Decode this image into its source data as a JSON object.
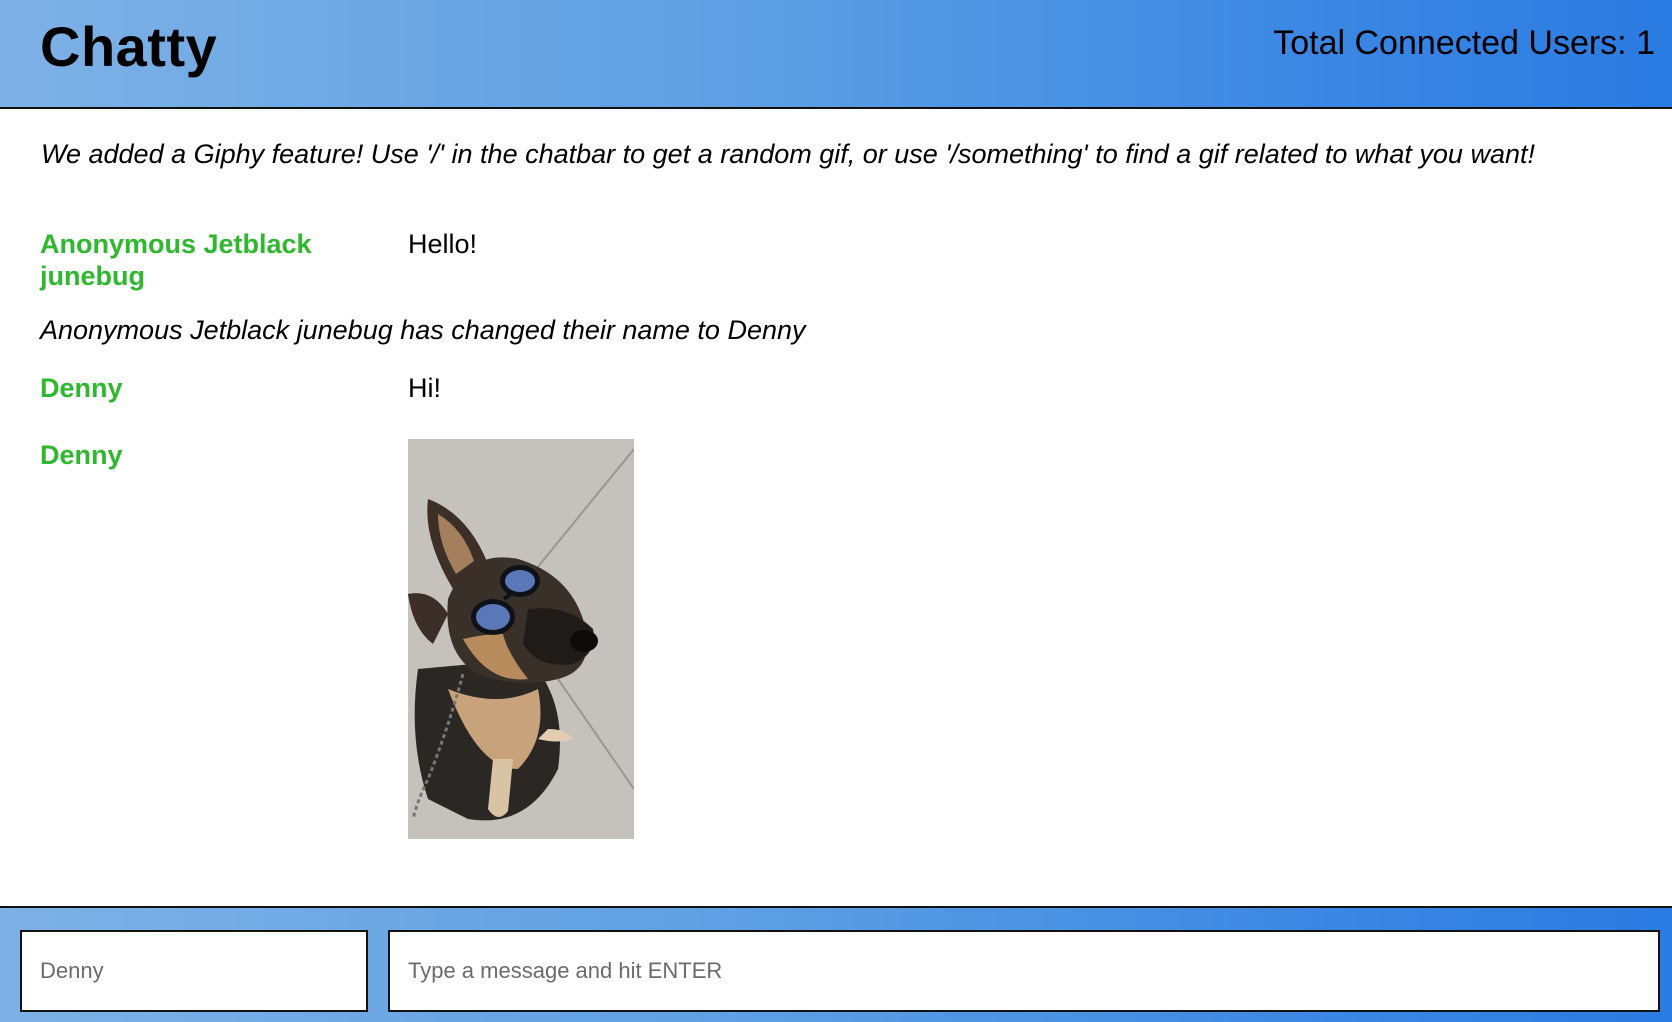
{
  "navbar": {
    "brand": "Chatty",
    "users_label": "Total Connected Users: 1"
  },
  "notice": "We added a Giphy feature! Use '/' in the chatbar to get a random gif, or use '/something' to find a gif related to what you want!",
  "messages": [
    {
      "type": "message",
      "username": "Anonymous Jetblack junebug",
      "content": "Hello!"
    },
    {
      "type": "system",
      "content": "Anonymous Jetblack junebug has changed their name to Denny"
    },
    {
      "type": "message",
      "username": "Denny",
      "content": "Hi!"
    },
    {
      "type": "image",
      "username": "Denny",
      "image": "german-shepherd-wearing-sunglasses-gif"
    }
  ],
  "chatbar": {
    "username_placeholder": "Denny",
    "message_placeholder": "Type a message and hit ENTER"
  },
  "colors": {
    "username": "#2eb82e",
    "bar_gradient_start": "#7eb1e6",
    "bar_gradient_end": "#2a7be2"
  }
}
